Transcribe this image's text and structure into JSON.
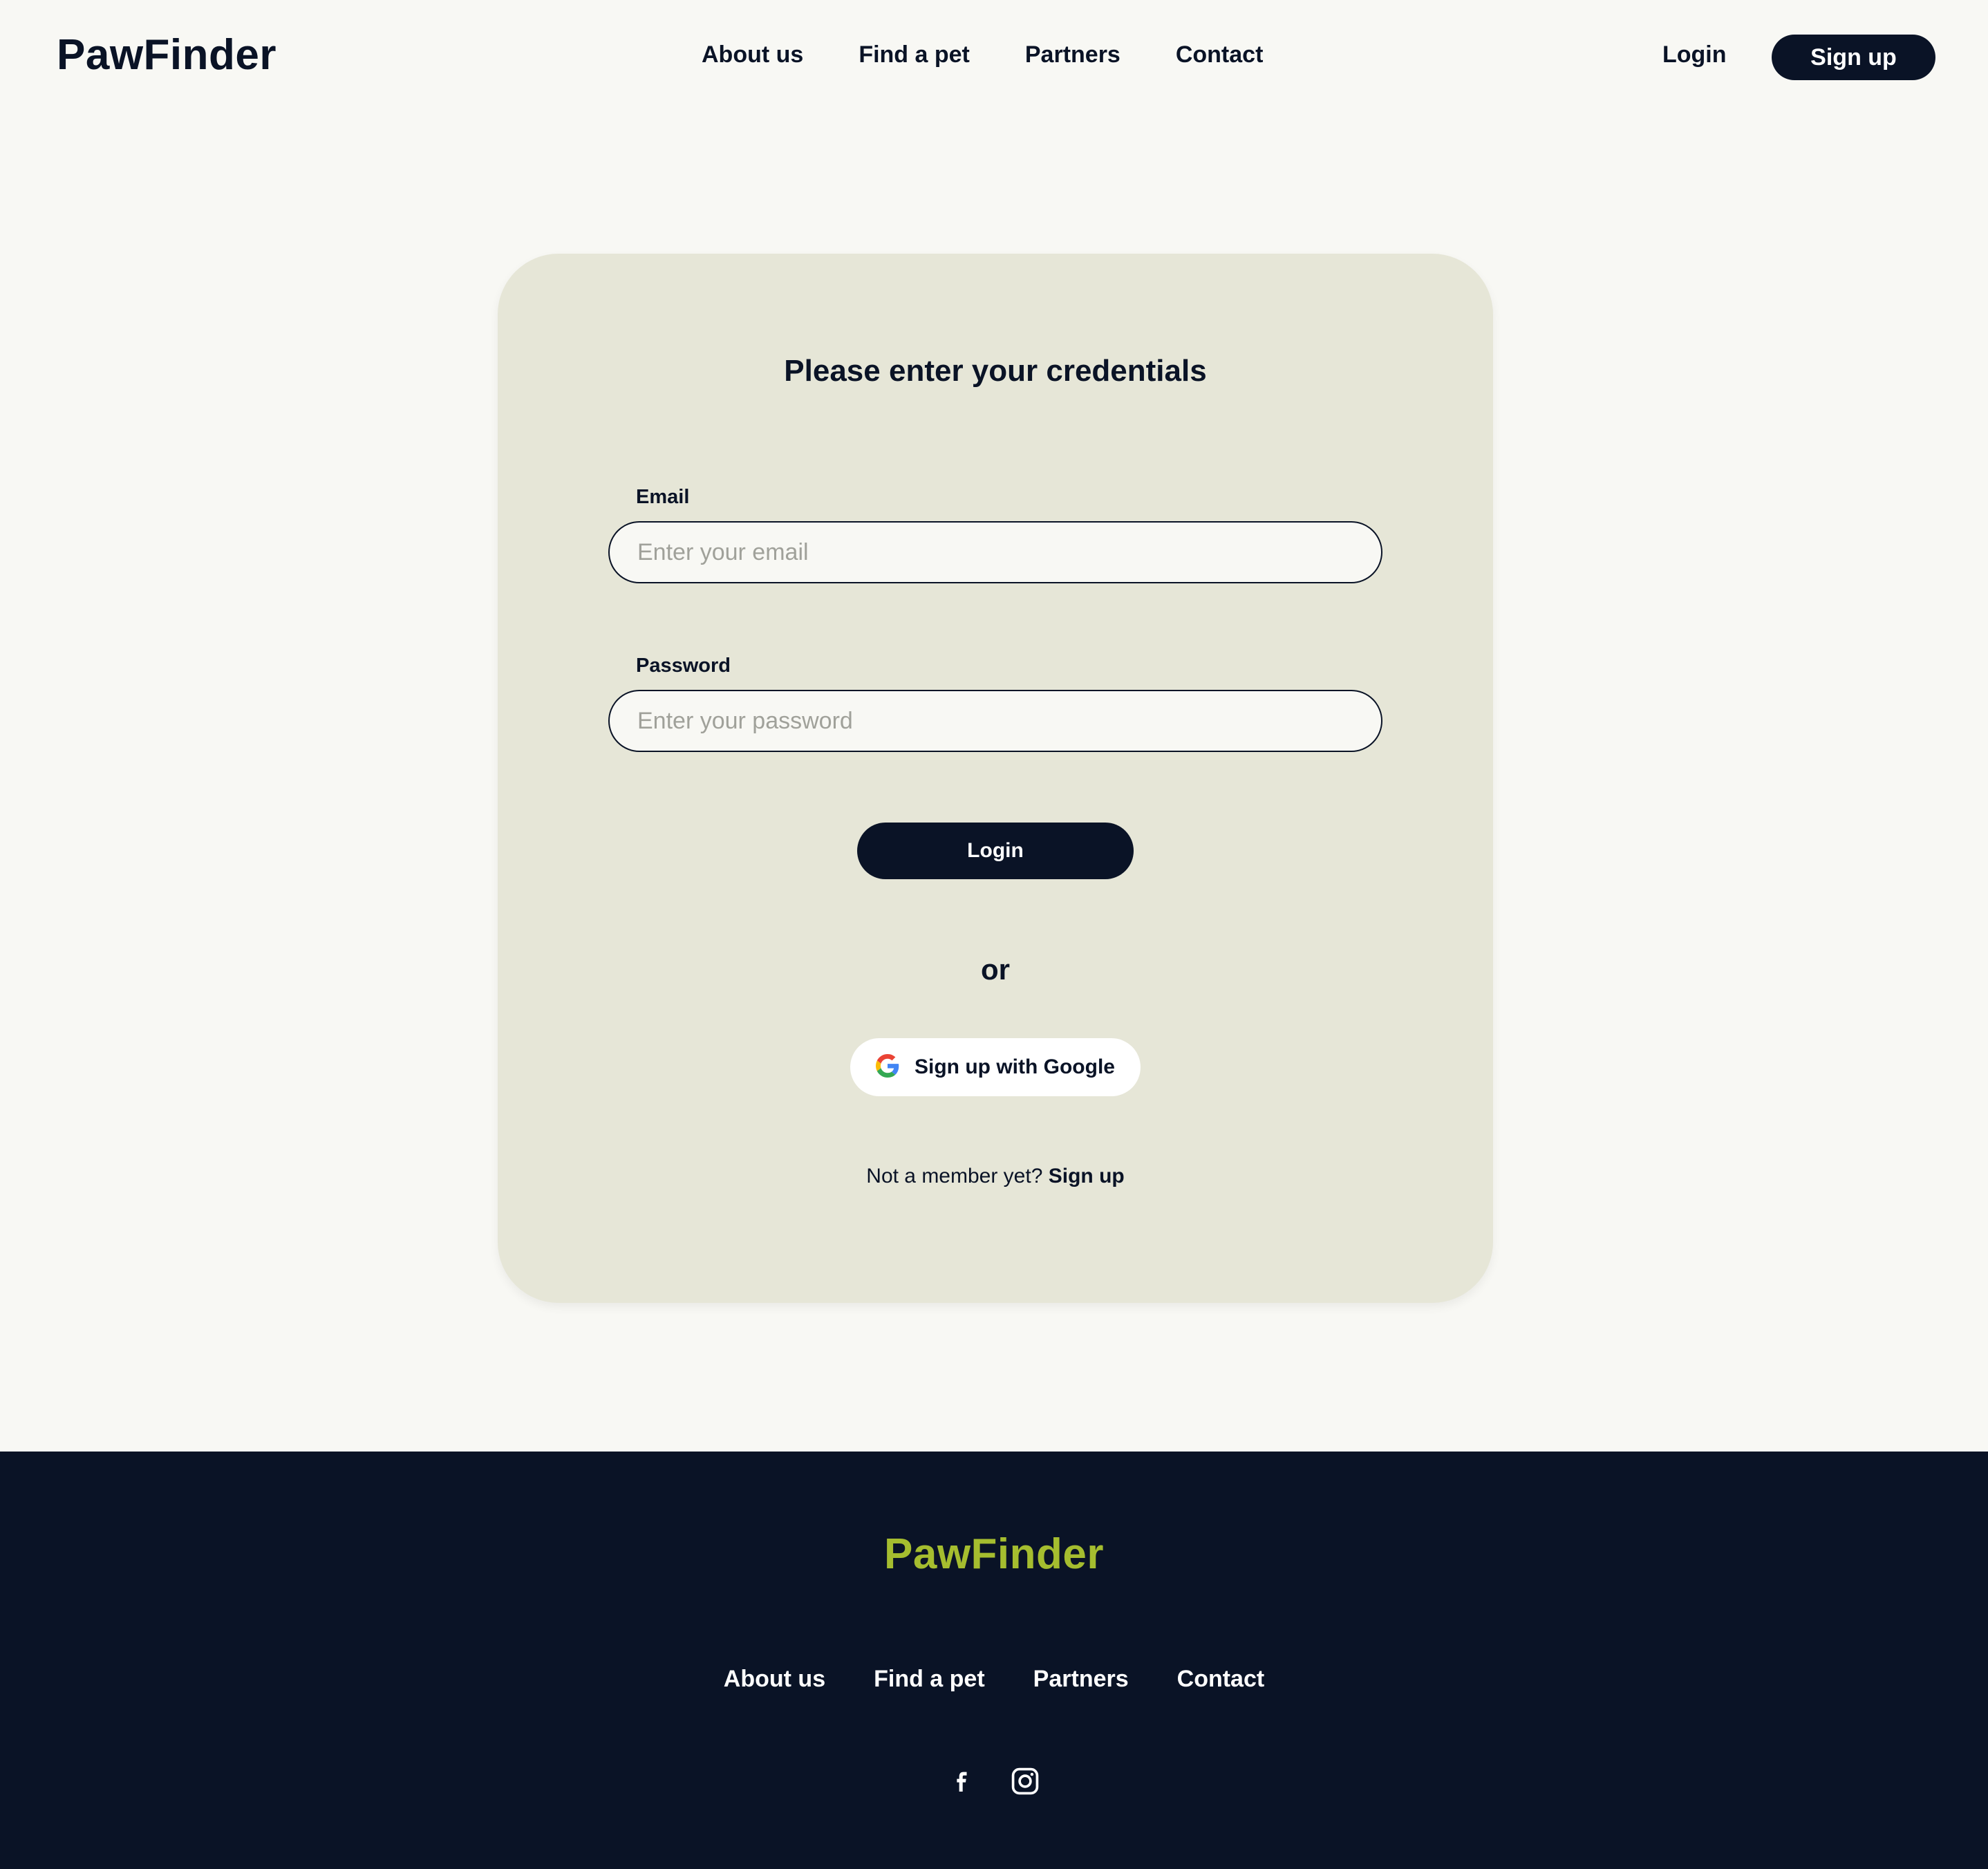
{
  "header": {
    "logo": "PawFinder",
    "nav": [
      "About us",
      "Find a pet",
      "Partners",
      "Contact"
    ],
    "login_label": "Login",
    "signup_label": "Sign up"
  },
  "form": {
    "title": "Please enter your credentials",
    "email": {
      "label": "Email",
      "placeholder": "Enter your email",
      "value": ""
    },
    "password": {
      "label": "Password",
      "placeholder": "Enter your password",
      "value": ""
    },
    "login_button": "Login",
    "divider": "or",
    "google_button": "Sign up with Google",
    "member_prompt": "Not a member yet?",
    "member_link": "Sign up"
  },
  "footer": {
    "logo": "PawFinder",
    "nav": [
      "About us",
      "Find a pet",
      "Partners",
      "Contact"
    ],
    "social_icons": [
      "facebook-icon",
      "instagram-icon"
    ]
  },
  "colors": {
    "background": "#f8f8f4",
    "card": "#e6e6d7",
    "primary": "#0a1326",
    "footer_logo": "#a5bd2f"
  }
}
